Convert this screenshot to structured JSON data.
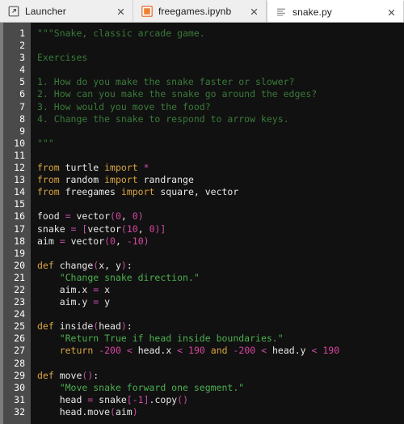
{
  "window": {
    "active_file": "snake.py"
  },
  "tabbar": {
    "tabs": [
      {
        "label": "Launcher",
        "icon": "launcher-icon",
        "active": false,
        "close": "close-icon"
      },
      {
        "label": "freegames.ipynb",
        "icon": "notebook-icon",
        "active": false,
        "close": "close-icon"
      },
      {
        "label": "snake.py",
        "icon": "text-file-icon",
        "active": true,
        "close": "close-icon"
      }
    ]
  },
  "editor": {
    "first_line": 1,
    "line_numbers": [
      1,
      2,
      3,
      4,
      5,
      6,
      7,
      8,
      9,
      10,
      11,
      12,
      13,
      14,
      15,
      16,
      17,
      18,
      19,
      20,
      21,
      22,
      23,
      24,
      25,
      26,
      27,
      28,
      29,
      30,
      31,
      32
    ],
    "colors": {
      "background": "#111111",
      "gutter": "#4a4a4a",
      "gutter_text": "#ffffff",
      "docstring": "#3a7a3a",
      "string": "#4caf50",
      "keyword": "#d9a441",
      "number": "#d946a0",
      "operator": "#c94fa8",
      "identifier": "#e8e8e8"
    },
    "lines": [
      [
        {
          "t": "doc",
          "s": "\"\"\"Snake, classic arcade game."
        }
      ],
      [],
      [
        {
          "t": "doc",
          "s": "Exercises"
        }
      ],
      [],
      [
        {
          "t": "doc",
          "s": "1. How do you make the snake faster or slower?"
        }
      ],
      [
        {
          "t": "doc",
          "s": "2. How can you make the snake go around the edges?"
        }
      ],
      [
        {
          "t": "doc",
          "s": "3. How would you move the food?"
        }
      ],
      [
        {
          "t": "doc",
          "s": "4. Change the snake to respond to arrow keys."
        }
      ],
      [],
      [
        {
          "t": "doc",
          "s": "\"\"\""
        }
      ],
      [],
      [
        {
          "t": "kw",
          "s": "from"
        },
        {
          "t": "plain",
          "s": " turtle "
        },
        {
          "t": "kw",
          "s": "import"
        },
        {
          "t": "plain",
          "s": " "
        },
        {
          "t": "op",
          "s": "*"
        }
      ],
      [
        {
          "t": "kw",
          "s": "from"
        },
        {
          "t": "plain",
          "s": " random "
        },
        {
          "t": "kw",
          "s": "import"
        },
        {
          "t": "plain",
          "s": " randrange"
        }
      ],
      [
        {
          "t": "kw",
          "s": "from"
        },
        {
          "t": "plain",
          "s": " freegames "
        },
        {
          "t": "kw",
          "s": "import"
        },
        {
          "t": "plain",
          "s": " square, vector"
        }
      ],
      [],
      [
        {
          "t": "plain",
          "s": "food "
        },
        {
          "t": "op",
          "s": "="
        },
        {
          "t": "plain",
          "s": " vector"
        },
        {
          "t": "op",
          "s": "("
        },
        {
          "t": "num",
          "s": "0"
        },
        {
          "t": "plain",
          "s": ", "
        },
        {
          "t": "num",
          "s": "0"
        },
        {
          "t": "op",
          "s": ")"
        }
      ],
      [
        {
          "t": "plain",
          "s": "snake "
        },
        {
          "t": "op",
          "s": "="
        },
        {
          "t": "plain",
          "s": " "
        },
        {
          "t": "op",
          "s": "["
        },
        {
          "t": "plain",
          "s": "vector"
        },
        {
          "t": "op",
          "s": "("
        },
        {
          "t": "num",
          "s": "10"
        },
        {
          "t": "plain",
          "s": ", "
        },
        {
          "t": "num",
          "s": "0"
        },
        {
          "t": "op",
          "s": ")]"
        }
      ],
      [
        {
          "t": "plain",
          "s": "aim "
        },
        {
          "t": "op",
          "s": "="
        },
        {
          "t": "plain",
          "s": " vector"
        },
        {
          "t": "op",
          "s": "("
        },
        {
          "t": "num",
          "s": "0"
        },
        {
          "t": "plain",
          "s": ", "
        },
        {
          "t": "op",
          "s": "-"
        },
        {
          "t": "num",
          "s": "10"
        },
        {
          "t": "op",
          "s": ")"
        }
      ],
      [],
      [
        {
          "t": "kw",
          "s": "def"
        },
        {
          "t": "plain",
          "s": " change"
        },
        {
          "t": "op",
          "s": "("
        },
        {
          "t": "plain",
          "s": "x, y"
        },
        {
          "t": "op",
          "s": ")"
        },
        {
          "t": "plain",
          "s": ":"
        }
      ],
      [
        {
          "t": "plain",
          "s": "    "
        },
        {
          "t": "str",
          "s": "\"Change snake direction.\""
        }
      ],
      [
        {
          "t": "plain",
          "s": "    aim.x "
        },
        {
          "t": "op",
          "s": "="
        },
        {
          "t": "plain",
          "s": " x"
        }
      ],
      [
        {
          "t": "plain",
          "s": "    aim.y "
        },
        {
          "t": "op",
          "s": "="
        },
        {
          "t": "plain",
          "s": " y"
        }
      ],
      [],
      [
        {
          "t": "kw",
          "s": "def"
        },
        {
          "t": "plain",
          "s": " inside"
        },
        {
          "t": "op",
          "s": "("
        },
        {
          "t": "plain",
          "s": "head"
        },
        {
          "t": "op",
          "s": ")"
        },
        {
          "t": "plain",
          "s": ":"
        }
      ],
      [
        {
          "t": "plain",
          "s": "    "
        },
        {
          "t": "str",
          "s": "\"Return True if head inside boundaries.\""
        }
      ],
      [
        {
          "t": "plain",
          "s": "    "
        },
        {
          "t": "kw",
          "s": "return"
        },
        {
          "t": "plain",
          "s": " "
        },
        {
          "t": "op",
          "s": "-"
        },
        {
          "t": "num",
          "s": "200"
        },
        {
          "t": "plain",
          "s": " "
        },
        {
          "t": "op",
          "s": "<"
        },
        {
          "t": "plain",
          "s": " head.x "
        },
        {
          "t": "op",
          "s": "<"
        },
        {
          "t": "plain",
          "s": " "
        },
        {
          "t": "num",
          "s": "190"
        },
        {
          "t": "plain",
          "s": " "
        },
        {
          "t": "kw",
          "s": "and"
        },
        {
          "t": "plain",
          "s": " "
        },
        {
          "t": "op",
          "s": "-"
        },
        {
          "t": "num",
          "s": "200"
        },
        {
          "t": "plain",
          "s": " "
        },
        {
          "t": "op",
          "s": "<"
        },
        {
          "t": "plain",
          "s": " head.y "
        },
        {
          "t": "op",
          "s": "<"
        },
        {
          "t": "plain",
          "s": " "
        },
        {
          "t": "num",
          "s": "190"
        }
      ],
      [],
      [
        {
          "t": "kw",
          "s": "def"
        },
        {
          "t": "plain",
          "s": " move"
        },
        {
          "t": "op",
          "s": "()"
        },
        {
          "t": "plain",
          "s": ":"
        }
      ],
      [
        {
          "t": "plain",
          "s": "    "
        },
        {
          "t": "str",
          "s": "\"Move snake forward one segment.\""
        }
      ],
      [
        {
          "t": "plain",
          "s": "    head "
        },
        {
          "t": "op",
          "s": "="
        },
        {
          "t": "plain",
          "s": " snake"
        },
        {
          "t": "op",
          "s": "["
        },
        {
          "t": "op",
          "s": "-"
        },
        {
          "t": "num",
          "s": "1"
        },
        {
          "t": "op",
          "s": "]"
        },
        {
          "t": "plain",
          "s": ".copy"
        },
        {
          "t": "op",
          "s": "()"
        }
      ],
      [
        {
          "t": "plain",
          "s": "    head.move"
        },
        {
          "t": "op",
          "s": "("
        },
        {
          "t": "plain",
          "s": "aim"
        },
        {
          "t": "op",
          "s": ")"
        }
      ]
    ]
  }
}
